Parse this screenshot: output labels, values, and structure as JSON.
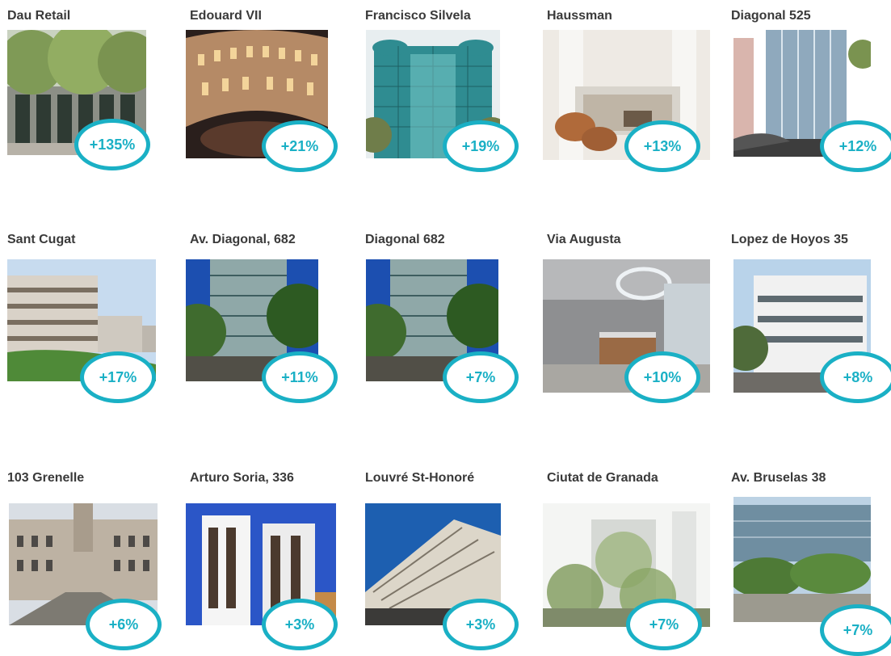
{
  "accent_color": "#1ab0c5",
  "properties": [
    {
      "name": "Dau Retail",
      "growth": "+135%",
      "photo": "street-building-with-trees"
    },
    {
      "name": "Edouard VII",
      "growth": "+21%",
      "photo": "courtyard-at-night"
    },
    {
      "name": "Francisco Silvela",
      "growth": "+19%",
      "photo": "glass-office-tower"
    },
    {
      "name": "Haussman",
      "growth": "+13%",
      "photo": "interior-atrium"
    },
    {
      "name": "Diagonal 525",
      "growth": "+12%",
      "photo": "glass-corner-building"
    },
    {
      "name": "Sant Cugat",
      "growth": "+17%",
      "photo": "office-campus-lawn"
    },
    {
      "name": "Av. Diagonal, 682",
      "growth": "+11%",
      "photo": "glass-building-with-palms"
    },
    {
      "name": "Diagonal 682",
      "growth": "+7%",
      "photo": "glass-building-with-palms"
    },
    {
      "name": "Via Augusta",
      "growth": "+10%",
      "photo": "lobby-reception"
    },
    {
      "name": "Lopez de Hoyos 35",
      "growth": "+8%",
      "photo": "white-office-building"
    },
    {
      "name": "103 Grenelle",
      "growth": "+6%",
      "photo": "classical-courtyard"
    },
    {
      "name": "Arturo Soria, 336",
      "growth": "+3%",
      "photo": "white-tower-blue-sky"
    },
    {
      "name": "Louvré St-Honoré",
      "growth": "+3%",
      "photo": "haussmann-building"
    },
    {
      "name": "Ciutat de Granada",
      "growth": "+7%",
      "photo": "green-facade-building"
    },
    {
      "name": "Av. Bruselas 38",
      "growth": "+7%",
      "photo": "glass-office-with-gardens"
    }
  ]
}
